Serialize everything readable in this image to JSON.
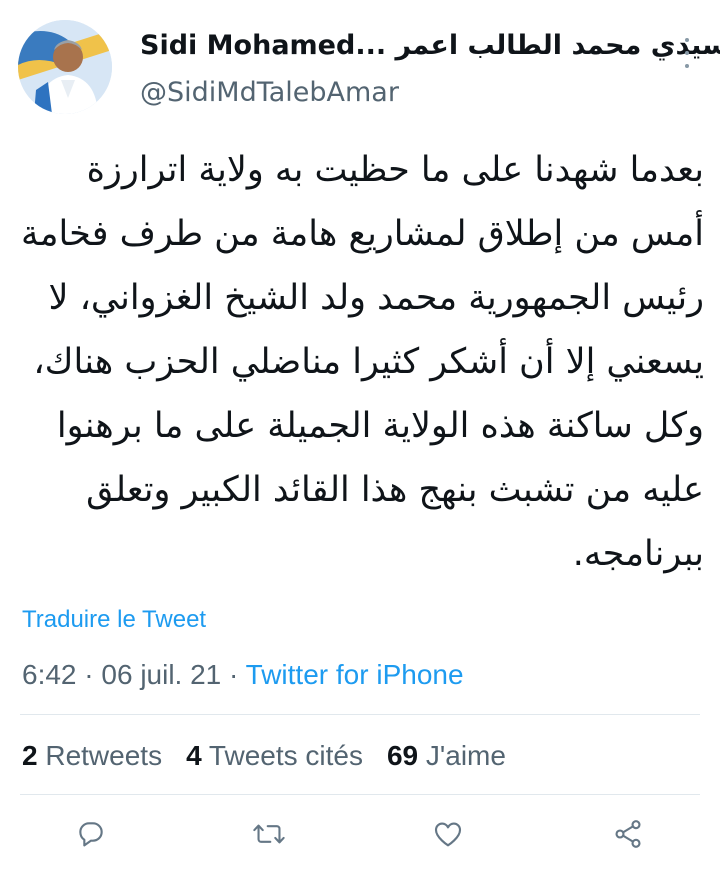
{
  "header": {
    "display_name": "Sidi Mohamed... سيدي محمد الطالب اعمر",
    "handle": "@SidiMdTalebAmar",
    "avatar_icon": "profile-photo",
    "more_icon": "more-vertical-icon"
  },
  "tweet": {
    "text": "بعدما شهدنا على ما حظيت به ولاية اترارزة أمس من إطلاق لمشاريع هامة من طرف فخامة رئيس الجمهورية محمد ولد الشيخ الغزواني، لا يسعني إلا أن أشكر كثيرا مناضلي الحزب هناك، وكل ساكنة هذه الولاية الجميلة على ما برهنوا عليه من تشبث بنهج هذا القائد الكبير وتعلق ببرنامجه."
  },
  "translate_label": "Traduire le Tweet",
  "meta": {
    "time": "6:42",
    "separator": " · ",
    "date": "06 juil. 21",
    "source": "Twitter for iPhone"
  },
  "stats": {
    "retweets_count": "2",
    "retweets_label": " Retweets",
    "quotes_count": "4",
    "quotes_label": " Tweets cités",
    "likes_count": "69",
    "likes_label": " J'aime"
  },
  "actions": {
    "icons": [
      "reply-icon",
      "retweet-icon",
      "like-icon",
      "share-icon"
    ]
  },
  "colors": {
    "accent": "#1d9bf0",
    "secondary_text": "#536471",
    "icon_gray": "#657786"
  }
}
